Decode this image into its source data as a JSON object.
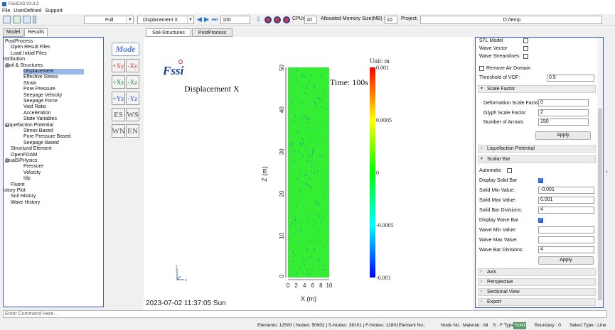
{
  "window": {
    "title": "FssiCAS V3.3.2"
  },
  "menu": [
    "File",
    "UserDefined",
    "Support"
  ],
  "toolbar": {
    "view_mode": "Full",
    "variable": "Displacement X",
    "frame": "100",
    "cpus_label": "CPUs",
    "cpus_value": "10",
    "memory_label": "Allocated Memory Size(MB) :",
    "memory_value": "10",
    "project_label": "Project:",
    "project_value": "D:/temp"
  },
  "left_tabs": [
    "Model",
    "Results"
  ],
  "tree": [
    {
      "label": "PostProcess",
      "level": 0,
      "exp": ""
    },
    {
      "label": "Open Result Files",
      "level": 1,
      "exp": ""
    },
    {
      "label": "Load Initial Files",
      "level": 1,
      "exp": ""
    },
    {
      "label": "Distribution",
      "level": 0,
      "exp": "⊟"
    },
    {
      "label": "Soil & Structures",
      "level": 1,
      "exp": "⊟"
    },
    {
      "label": "Displacement",
      "level": 2,
      "exp": "",
      "selected": true
    },
    {
      "label": "Effective Stress",
      "level": 2,
      "exp": ""
    },
    {
      "label": "Strain",
      "level": 2,
      "exp": ""
    },
    {
      "label": "Pore Pressure",
      "level": 2,
      "exp": ""
    },
    {
      "label": "Seepage Velocity",
      "level": 2,
      "exp": ""
    },
    {
      "label": "Seepage Force",
      "level": 2,
      "exp": ""
    },
    {
      "label": "Void Ratio",
      "level": 2,
      "exp": ""
    },
    {
      "label": "Acceleration",
      "level": 2,
      "exp": ""
    },
    {
      "label": "State Variables",
      "level": 2,
      "exp": ""
    },
    {
      "label": "Liquefaction Potential",
      "level": 1,
      "exp": "⊟"
    },
    {
      "label": "Stress Based",
      "level": 2,
      "exp": ""
    },
    {
      "label": "Pore Pressure Based",
      "level": 2,
      "exp": ""
    },
    {
      "label": "Seepage Based",
      "level": 2,
      "exp": ""
    },
    {
      "label": "Structural Element",
      "level": 1,
      "exp": ""
    },
    {
      "label": "OpenFOAM",
      "level": 1,
      "exp": ""
    },
    {
      "label": "DualSPHysics",
      "level": 1,
      "exp": "⊟"
    },
    {
      "label": "Pressure",
      "level": 2,
      "exp": ""
    },
    {
      "label": "Velocity",
      "level": 2,
      "exp": ""
    },
    {
      "label": "Idp",
      "level": 2,
      "exp": ""
    },
    {
      "label": "Fluent",
      "level": 1,
      "exp": ""
    },
    {
      "label": "History Plot",
      "level": 0,
      "exp": "⊟"
    },
    {
      "label": "Soil History",
      "level": 1,
      "exp": ""
    },
    {
      "label": "Wave History",
      "level": 1,
      "exp": ""
    }
  ],
  "icons": {
    "mode": "Mode",
    "views": [
      [
        "+Xy",
        "-Xy"
      ],
      [
        "+Xz",
        "-Xz"
      ],
      [
        "+Yz",
        "-Yz"
      ],
      [
        "ES",
        "WS"
      ],
      [
        "WN",
        "EN"
      ]
    ]
  },
  "center_tabs": [
    "Soil-Structures",
    "PostProcess"
  ],
  "viewport": {
    "logo": "Fssi",
    "title": "Displacement X",
    "time": "Time: 100s",
    "unit": "Unit:  m",
    "colorbar_labels": [
      "0.001",
      "0.0005",
      "0",
      "-0.0005",
      "-0.001"
    ],
    "y_ticks": [
      "50",
      "40",
      "30",
      "20",
      "10",
      "0"
    ],
    "x_ticks": [
      "0",
      "2",
      "4",
      "6",
      "8",
      "10"
    ],
    "y_label": "Z (m)",
    "x_label": "X (m)",
    "timestamp": "2023-07-02 11:37:05 Sun",
    "field_color": "#33ee33"
  },
  "right_panel": {
    "stl_model": "STL Model",
    "wave_vector": "Wave Vector",
    "wave_streamlines": "Wave Streamlines",
    "remove_air": "Remove Air Domain",
    "threshold_label": "Threshold of VOF:",
    "threshold_value": "0.5",
    "scale_factor": "Scale Factor",
    "deform_label": "Deformation Scale Factor",
    "deform_value": "0",
    "glyph_label": "Glyph Scale Factor",
    "glyph_value": "2",
    "arrows_label": "Number of Arrows",
    "arrows_value": "150",
    "apply": "Apply",
    "liquefaction": "Liquefaction Potential",
    "scalar_bar": "Scalar Bar",
    "automatic": "Automatic",
    "display_solid": "Display Solid Bar",
    "solid_min_label": "Solid Min Value:",
    "solid_min": "-0.001",
    "solid_max_label": "Solid Max Value:",
    "solid_max": "0.001",
    "solid_div_label": "Solid Bar Divisions:",
    "solid_div": "4",
    "display_wave": "Display Wave Bar",
    "wave_min_label": "Wave Min Value:",
    "wave_max_label": "Wave Max Value:",
    "wave_div_label": "Wave Bar Divisions:",
    "wave_div": "4",
    "axis": "Axis",
    "perspective": "Perspective",
    "sectional": "Sectional View",
    "export": "Export"
  },
  "command_placeholder": "Enter Command Here...",
  "status": {
    "elements": "Elements: 12500 | Nodes: 50902 | S-Nodes: 38101 | F-Nodes: 12801",
    "element_no": "Element No.:",
    "node_no": "Node No.:",
    "material": "Material :  All",
    "sf_type": "S - F Type :",
    "sf_value": "Solid",
    "boundary": "Boundary :  0",
    "select_type": "Select Type :  Line"
  }
}
